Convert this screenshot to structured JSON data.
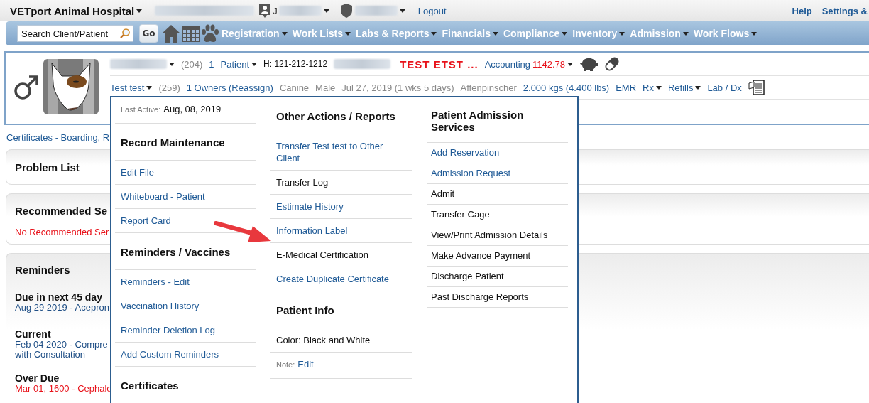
{
  "header": {
    "hospital": "VETport Animal Hospital",
    "user_initial": "J",
    "logout": "Logout",
    "links": [
      "Help",
      "Settings &"
    ]
  },
  "nav": {
    "search": {
      "placeholder": "Search Client/Patient"
    },
    "go": "Go",
    "menus": [
      "Registration",
      "Work Lists",
      "Labs & Reports",
      "Financials",
      "Compliance",
      "Inventory",
      "Admission",
      "Work Flows"
    ]
  },
  "patient": {
    "row1": [
      {
        "kind": "redacted",
        "dropdown": true
      },
      {
        "kind": "muted",
        "text": "(204)"
      },
      {
        "kind": "link",
        "text": "1"
      },
      {
        "kind": "link",
        "text": "Patient",
        "dropdown": true
      },
      {
        "kind": "plain",
        "text": "H: 121-212-1212"
      },
      {
        "kind": "redacted"
      },
      {
        "kind": "alert",
        "text": "TEST ETST ..."
      },
      {
        "kind": "link",
        "text": "Accounting"
      },
      {
        "kind": "danger",
        "text": "1142.78",
        "dropdown": true
      }
    ],
    "row2": [
      {
        "kind": "link",
        "text": "Test test",
        "dropdown": true
      },
      {
        "kind": "muted",
        "text": "(259)"
      },
      {
        "kind": "link",
        "text": "1 Owners (Reassign)"
      },
      {
        "kind": "muted",
        "text": "Canine"
      },
      {
        "kind": "muted",
        "text": "Male"
      },
      {
        "kind": "muted",
        "text": "Jul 27, 2019 (1 wks 5 days)"
      },
      {
        "kind": "muted",
        "text": "Affenpinscher"
      },
      {
        "kind": "link",
        "text": "2.000 kgs (4.400 lbs)"
      },
      {
        "kind": "link",
        "text": "EMR"
      },
      {
        "kind": "link",
        "text": "Rx",
        "dropdown": true
      },
      {
        "kind": "link",
        "text": "Refills",
        "dropdown": true
      },
      {
        "kind": "link",
        "text": "Lab / Dx"
      }
    ]
  },
  "certificates_link": "Certificates - Boarding, R",
  "cards": {
    "problem_list": {
      "title": "Problem List"
    },
    "recommended": {
      "title": "Recommended Se",
      "empty": "No Recommended Ser"
    },
    "reminders": {
      "title": "Reminders",
      "groups": [
        {
          "heading": "Due in next 45 day",
          "lines": [
            "Aug 29 2019 - Acepron"
          ],
          "overdue": false
        },
        {
          "heading": "Current",
          "lines": [
            "Feb 04 2020 - Compre",
            "with Consultation"
          ],
          "overdue": false
        },
        {
          "heading": "Over Due",
          "lines": [
            "Mar 01, 1600 - Cephale"
          ],
          "overdue": true
        }
      ]
    }
  },
  "menu": {
    "columns": [
      {
        "rows": [
          {
            "kind": "meta",
            "label": "Last Active:",
            "text": "Aug, 08, 2019"
          },
          {
            "kind": "heading",
            "text": "Record Maintenance"
          },
          {
            "kind": "link",
            "text": "Edit File"
          },
          {
            "kind": "link",
            "text": "Whiteboard - Patient"
          },
          {
            "kind": "link",
            "text": "Report Card"
          },
          {
            "kind": "heading",
            "text": "Reminders / Vaccines"
          },
          {
            "kind": "link",
            "text": "Reminders - Edit"
          },
          {
            "kind": "link",
            "text": "Vaccination History"
          },
          {
            "kind": "link",
            "text": "Reminder Deletion Log"
          },
          {
            "kind": "link",
            "text": "Add Custom Reminders"
          },
          {
            "kind": "heading",
            "text": "Certificates"
          }
        ]
      },
      {
        "rows": [
          {
            "kind": "heading",
            "text": "Other Actions / Reports"
          },
          {
            "kind": "link",
            "text": "Transfer Test test to Other Client"
          },
          {
            "kind": "action",
            "text": "Transfer Log"
          },
          {
            "kind": "link",
            "text": "Estimate History"
          },
          {
            "kind": "link",
            "text": "Information Label"
          },
          {
            "kind": "action",
            "text": "E-Medical Certification"
          },
          {
            "kind": "link",
            "text": "Create Duplicate Certificate"
          },
          {
            "kind": "heading",
            "text": "Patient Info"
          },
          {
            "kind": "action",
            "text": "Color: Black and White"
          },
          {
            "kind": "meta",
            "label": "Note:",
            "text": "Edit"
          }
        ]
      },
      {
        "rows": [
          {
            "kind": "heading",
            "text": "Patient Admission Services"
          },
          {
            "kind": "link",
            "text": "Add Reservation"
          },
          {
            "kind": "link",
            "text": "Admission Request"
          },
          {
            "kind": "action",
            "text": "Admit"
          },
          {
            "kind": "action",
            "text": "Transfer Cage"
          },
          {
            "kind": "action",
            "text": "View/Print Admission Details"
          },
          {
            "kind": "action",
            "text": "Make Advance Payment"
          },
          {
            "kind": "action",
            "text": "Discharge Patient"
          },
          {
            "kind": "action",
            "text": "Past Discharge Reports"
          }
        ]
      }
    ]
  }
}
